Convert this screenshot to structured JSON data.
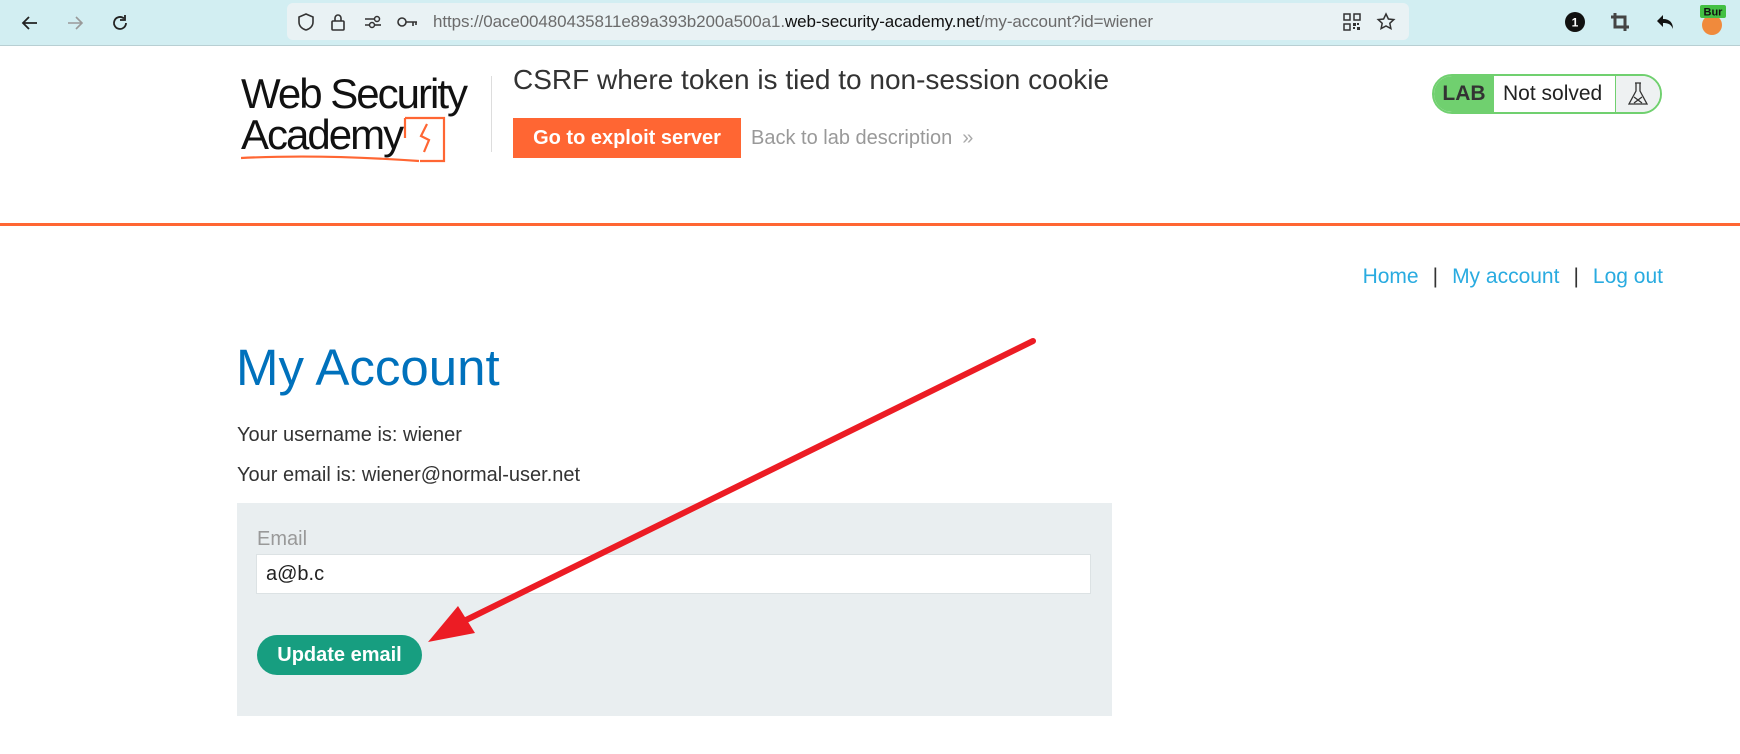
{
  "browser": {
    "url_prefix": "https://0ace00480435811e89a393b200a500a1.",
    "url_host": "web-security-academy.net",
    "url_path": "/my-account?id=wiener",
    "extension_badge_count": "1",
    "extension_label": "Bur",
    "icons": [
      "back-icon",
      "forward-icon",
      "reload-icon",
      "shield-icon",
      "lock-icon",
      "permissions-icon",
      "key-icon",
      "qr-code-icon",
      "bookmark-star-icon",
      "extension-badge-icon",
      "crop-icon",
      "undo-icon",
      "burp-extension-icon"
    ]
  },
  "header": {
    "logo_line1": "Web Security",
    "logo_line2": "Academy",
    "lab_title": "CSRF where token is tied to non-session cookie",
    "exploit_button": "Go to exploit server",
    "back_link": "Back to lab description",
    "back_chevron": "»",
    "lab_badge": {
      "label": "LAB",
      "status": "Not solved"
    }
  },
  "nav": {
    "items": [
      {
        "label": "Home"
      },
      {
        "label": "My account"
      },
      {
        "label": "Log out"
      }
    ],
    "separator": "|"
  },
  "main": {
    "title": "My Account",
    "username_line": "Your username is: wiener",
    "email_line": "Your email is: wiener@normal-user.net",
    "form": {
      "email_label": "Email",
      "email_value": "a@b.c",
      "submit_label": "Update email"
    }
  },
  "colors": {
    "brand_orange": "#ff6633",
    "title_blue": "#0071bc",
    "link_blue": "#29abe0",
    "submit_green": "#179e80",
    "lab_green": "#70d06f",
    "annotation_red": "#ec1c24"
  }
}
